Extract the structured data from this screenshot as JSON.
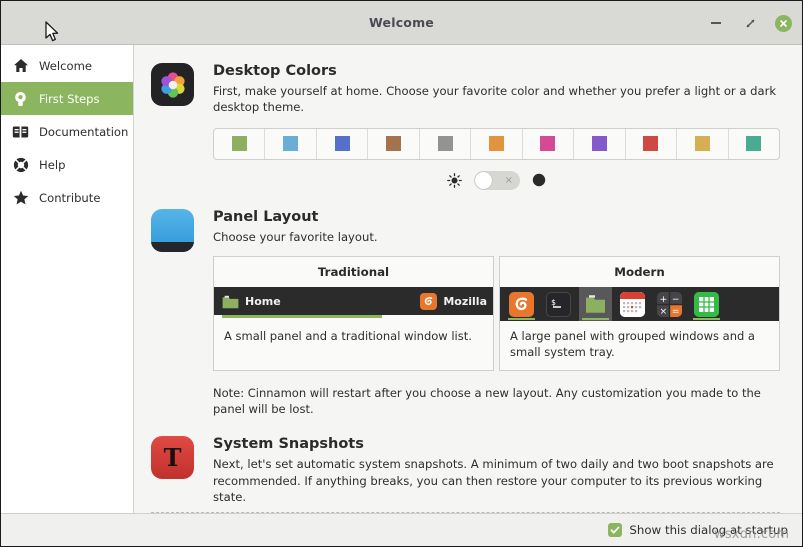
{
  "window": {
    "title": "Welcome",
    "controls": {
      "minimize": "minimize-button",
      "maximize": "maximize-button",
      "close": "close-button"
    }
  },
  "sidebar": {
    "items": [
      {
        "label": "Welcome",
        "icon": "home-icon",
        "active": false
      },
      {
        "label": "First Steps",
        "icon": "lightbulb-icon",
        "active": true
      },
      {
        "label": "Documentation",
        "icon": "book-icon",
        "active": false
      },
      {
        "label": "Help",
        "icon": "lifebuoy-icon",
        "active": false
      },
      {
        "label": "Contribute",
        "icon": "star-icon",
        "active": false
      }
    ]
  },
  "sections": {
    "desktop_colors": {
      "title": "Desktop Colors",
      "description": "First, make yourself at home. Choose your favorite color and whether you prefer a light or a dark desktop theme.",
      "icon": "color-wheel-icon",
      "swatches": [
        {
          "name": "green",
          "color": "#8cb05f"
        },
        {
          "name": "sky",
          "color": "#6cadd6"
        },
        {
          "name": "blue",
          "color": "#5570c9"
        },
        {
          "name": "brown",
          "color": "#a4724c"
        },
        {
          "name": "grey",
          "color": "#939393"
        },
        {
          "name": "orange",
          "color": "#e2933f"
        },
        {
          "name": "pink",
          "color": "#d44a94"
        },
        {
          "name": "purple",
          "color": "#8558cc"
        },
        {
          "name": "red",
          "color": "#cc4a42"
        },
        {
          "name": "yellow",
          "color": "#d4b052"
        },
        {
          "name": "teal",
          "color": "#49ab92"
        }
      ],
      "theme_toggle": {
        "light_icon": "sun-icon",
        "dark_icon": "moon-icon",
        "state": "off",
        "knob_mark": "×"
      }
    },
    "panel_layout": {
      "title": "Panel Layout",
      "description": "Choose your favorite layout.",
      "icon": "panel-icon",
      "cards": [
        {
          "name": "traditional",
          "title": "Traditional",
          "description": "A small panel and a traditional window list.",
          "preview_items": [
            {
              "label": "Home",
              "icon": "folder-icon"
            },
            {
              "label": "Mozilla",
              "icon": "firefox-icon"
            }
          ]
        },
        {
          "name": "modern",
          "title": "Modern",
          "description": "A large panel with grouped windows and a small system tray.",
          "preview_items": [
            {
              "label": "Firefox",
              "icon": "firefox-icon"
            },
            {
              "label": "Terminal",
              "icon": "terminal-icon"
            },
            {
              "label": "Files",
              "icon": "folder-icon"
            },
            {
              "label": "Calendar",
              "icon": "calendar-icon"
            },
            {
              "label": "Calculator",
              "icon": "calculator-icon"
            },
            {
              "label": "Spreadsheet",
              "icon": "spreadsheet-icon"
            }
          ]
        }
      ],
      "note": "Note: Cinnamon will restart after you choose a new layout. Any customization you made to the panel will be lost."
    },
    "system_snapshots": {
      "title": "System Snapshots",
      "description": "Next, let's set automatic system snapshots. A minimum of two daily and two boot snapshots are recommended. If anything breaks, you can then restore your computer to its previous working state.",
      "icon": "timeshift-icon",
      "icon_glyph": "T"
    }
  },
  "footer": {
    "startup_checkbox": {
      "label": "Show this dialog at startup",
      "checked": true
    }
  },
  "watermark": "wsxdn.com",
  "colors": {
    "accent": "#8cb55f",
    "titlebar": "#d9d9d6",
    "content_bg": "#f5f5f4",
    "sidebar_bg": "#ffffff"
  }
}
